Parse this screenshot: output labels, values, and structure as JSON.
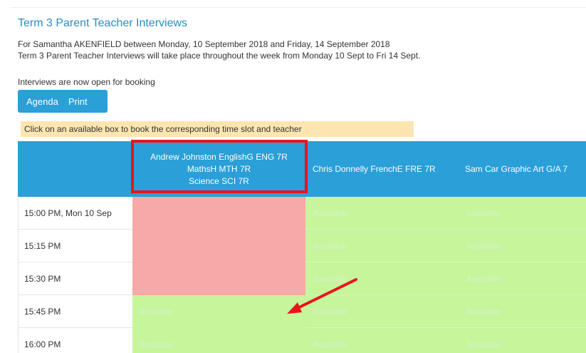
{
  "page": {
    "title": "Term 3 Parent Teacher Interviews",
    "subtitle": "For Samantha AKENFIELD between Monday, 10 September 2018 and Friday, 14 September 2018",
    "description": "Term 3 Parent Teacher Interviews will take place throughout the week from Monday 10 Sept to Fri 14 Sept.",
    "status": "Interviews are now open for booking"
  },
  "toolbar": {
    "agenda_label": "Agenda",
    "print_label": "Print"
  },
  "hint": "Click on an available box to book the corresponding time slot and teacher",
  "teachers": [
    {
      "lines": [
        "Andrew Johnston EnglishG ENG 7R",
        "MathsH MTH 7R",
        "Science SCI 7R"
      ]
    },
    {
      "lines": [
        "Chris Donnelly FrenchE FRE 7R"
      ]
    },
    {
      "lines": [
        "Sam Car Graphic Art G/A 7"
      ]
    }
  ],
  "slots": [
    {
      "time": "15:00 PM, Mon 10 Sep",
      "cells": [
        {
          "state": "booked",
          "text": ""
        },
        {
          "state": "available",
          "text": "Available"
        },
        {
          "state": "available",
          "text": "Available"
        }
      ]
    },
    {
      "time": "15:15 PM",
      "cells": [
        {
          "state": "booked",
          "text": ""
        },
        {
          "state": "available",
          "text": "Available"
        },
        {
          "state": "available",
          "text": "Available"
        }
      ]
    },
    {
      "time": "15:30 PM",
      "cells": [
        {
          "state": "booked",
          "text": ""
        },
        {
          "state": "available",
          "text": "Available"
        },
        {
          "state": "available",
          "text": "Available"
        }
      ]
    },
    {
      "time": "15:45 PM",
      "cells": [
        {
          "state": "available",
          "text": "Available"
        },
        {
          "state": "available",
          "text": "Available"
        },
        {
          "state": "available",
          "text": "Available"
        }
      ]
    },
    {
      "time": "16:00 PM",
      "cells": [
        {
          "state": "available",
          "text": "Available"
        },
        {
          "state": "available",
          "text": "Available"
        },
        {
          "state": "available",
          "text": "Available"
        }
      ]
    }
  ],
  "colors": {
    "accent": "#2a9fd8",
    "title": "#2b8cc4",
    "booked": "#f7a8a8",
    "available": "#c6f59c",
    "hint_bg": "#fce5b0",
    "annotation": "#e8141c"
  }
}
